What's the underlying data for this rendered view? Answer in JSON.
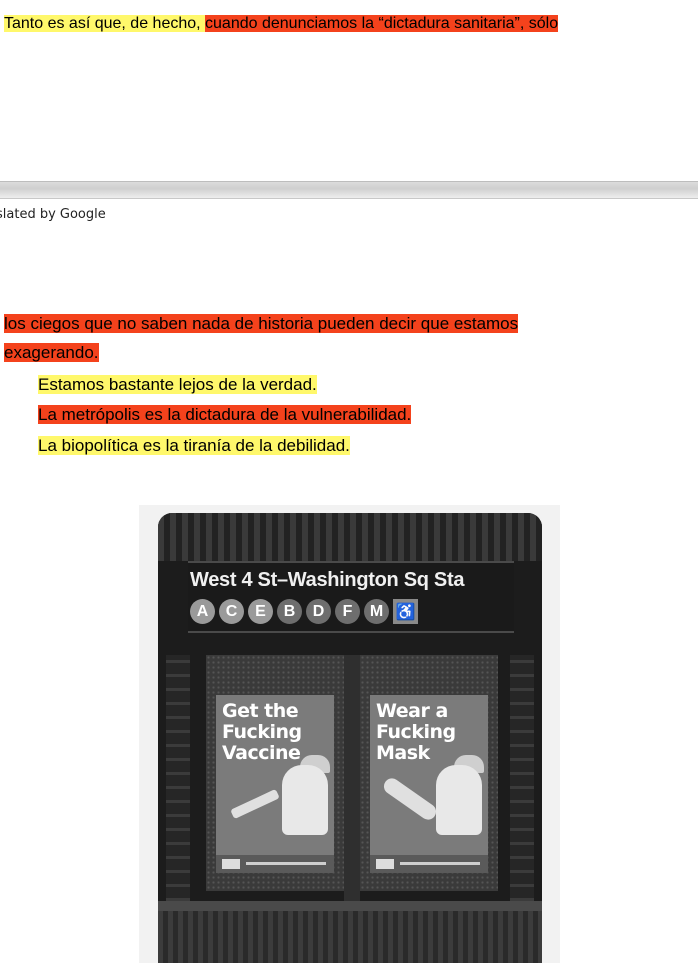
{
  "top_line": {
    "part1": "Tanto es así que, de hecho, ",
    "part2": "cuando denunciamos la “dictadura sanitaria”, sólo"
  },
  "translated_label": "slated by Google",
  "paragraphs": {
    "line1": "los ciegos que no saben nada de historia pueden decir que estamos",
    "line2": "exagerando.",
    "line3": "Estamos bastante lejos de la verdad.",
    "line4": "La metrópolis es la dictadura de la vulnerabilidad.",
    "line5": "La biopolítica es la tiranía de la debilidad."
  },
  "photo": {
    "station_name": "West 4 St–Washington Sq Sta",
    "lines": [
      "A",
      "C",
      "E",
      "B",
      "D",
      "F",
      "M"
    ],
    "accessible_icon": "wheelchair-icon",
    "poster_left": "Get the\nFucking\nVaccine",
    "poster_right": "Wear a\nFucking\nMask"
  },
  "colors": {
    "highlight_yellow": "#fff86b",
    "highlight_red": "#f4421c"
  }
}
